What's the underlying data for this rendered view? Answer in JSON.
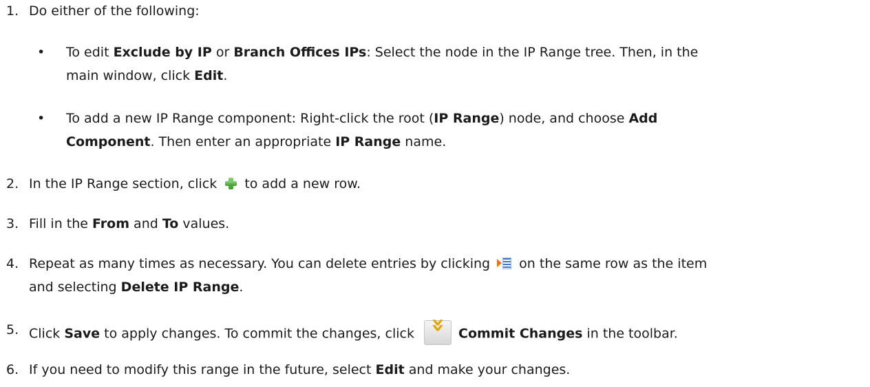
{
  "steps": {
    "s1": {
      "num": "1.",
      "text": "Do either of the following:"
    },
    "b1": {
      "line1_a": "To edit ",
      "line1_b": "Exclude by IP",
      "line1_c": " or ",
      "line1_d": "Branch Offices IPs",
      "line1_e": ": Select the node in the IP Range tree. Then, in the",
      "line2_a": "main window, click ",
      "line2_b": "Edit",
      "line2_c": "."
    },
    "b2": {
      "line1_a": "To add a new IP Range component: Right-click the root (",
      "line1_b": "IP Range",
      "line1_c": ") node, and choose ",
      "line1_d": "Add",
      "line2_a": "Component",
      "line2_b": ". Then enter an appropriate ",
      "line2_c": "IP Range",
      "line2_d": " name."
    },
    "s2": {
      "num": "2.",
      "a": "In the IP Range section, click ",
      "b": " to add a new row."
    },
    "s3": {
      "num": "3.",
      "a": "Fill in the ",
      "b": "From",
      "c": " and ",
      "d": "To",
      "e": " values."
    },
    "s4": {
      "num": "4.",
      "line1_a": "Repeat as many times as necessary. You can delete entries by clicking ",
      "line1_b": " on the same row as the item",
      "line2_a": "and selecting ",
      "line2_b": "Delete IP Range",
      "line2_c": "."
    },
    "s5": {
      "num": "5.",
      "a": "Click ",
      "b": "Save",
      "c": " to apply changes. To commit the changes, click ",
      "d": "Commit Changes",
      "e": " in the toolbar."
    },
    "s6": {
      "num": "6.",
      "a": "If you need to modify this range in the future, select ",
      "b": "Edit",
      "c": " and make your changes."
    }
  },
  "bullet_char": "•",
  "icons": [
    "plus-icon",
    "row-menu-icon",
    "commit-changes-icon"
  ]
}
